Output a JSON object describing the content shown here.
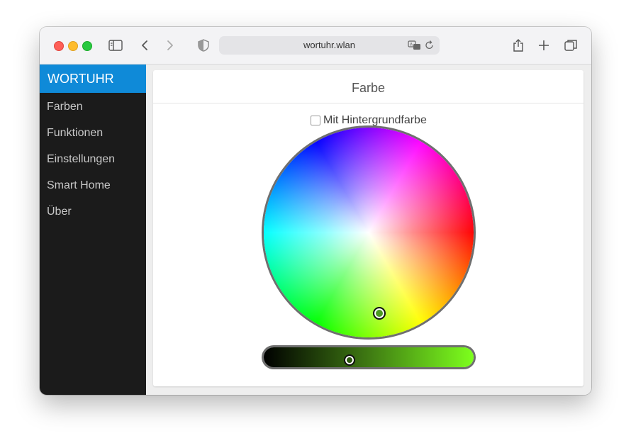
{
  "browser": {
    "url": "wortuhr.wlan"
  },
  "sidebar": {
    "brand": "WORTUHR",
    "items": [
      {
        "label": "Farben"
      },
      {
        "label": "Funktionen"
      },
      {
        "label": "Einstellungen"
      },
      {
        "label": "Smart Home"
      },
      {
        "label": "Über"
      }
    ]
  },
  "main": {
    "card_title": "Farbe",
    "checkbox_label": "Mit Hintergrundfarbe",
    "checkbox_checked": false,
    "selected_color": "#4a9a20",
    "brightness_fraction": 0.41
  },
  "colors": {
    "brand": "#0f8ad8",
    "sidebar_bg": "#1b1b1b"
  }
}
